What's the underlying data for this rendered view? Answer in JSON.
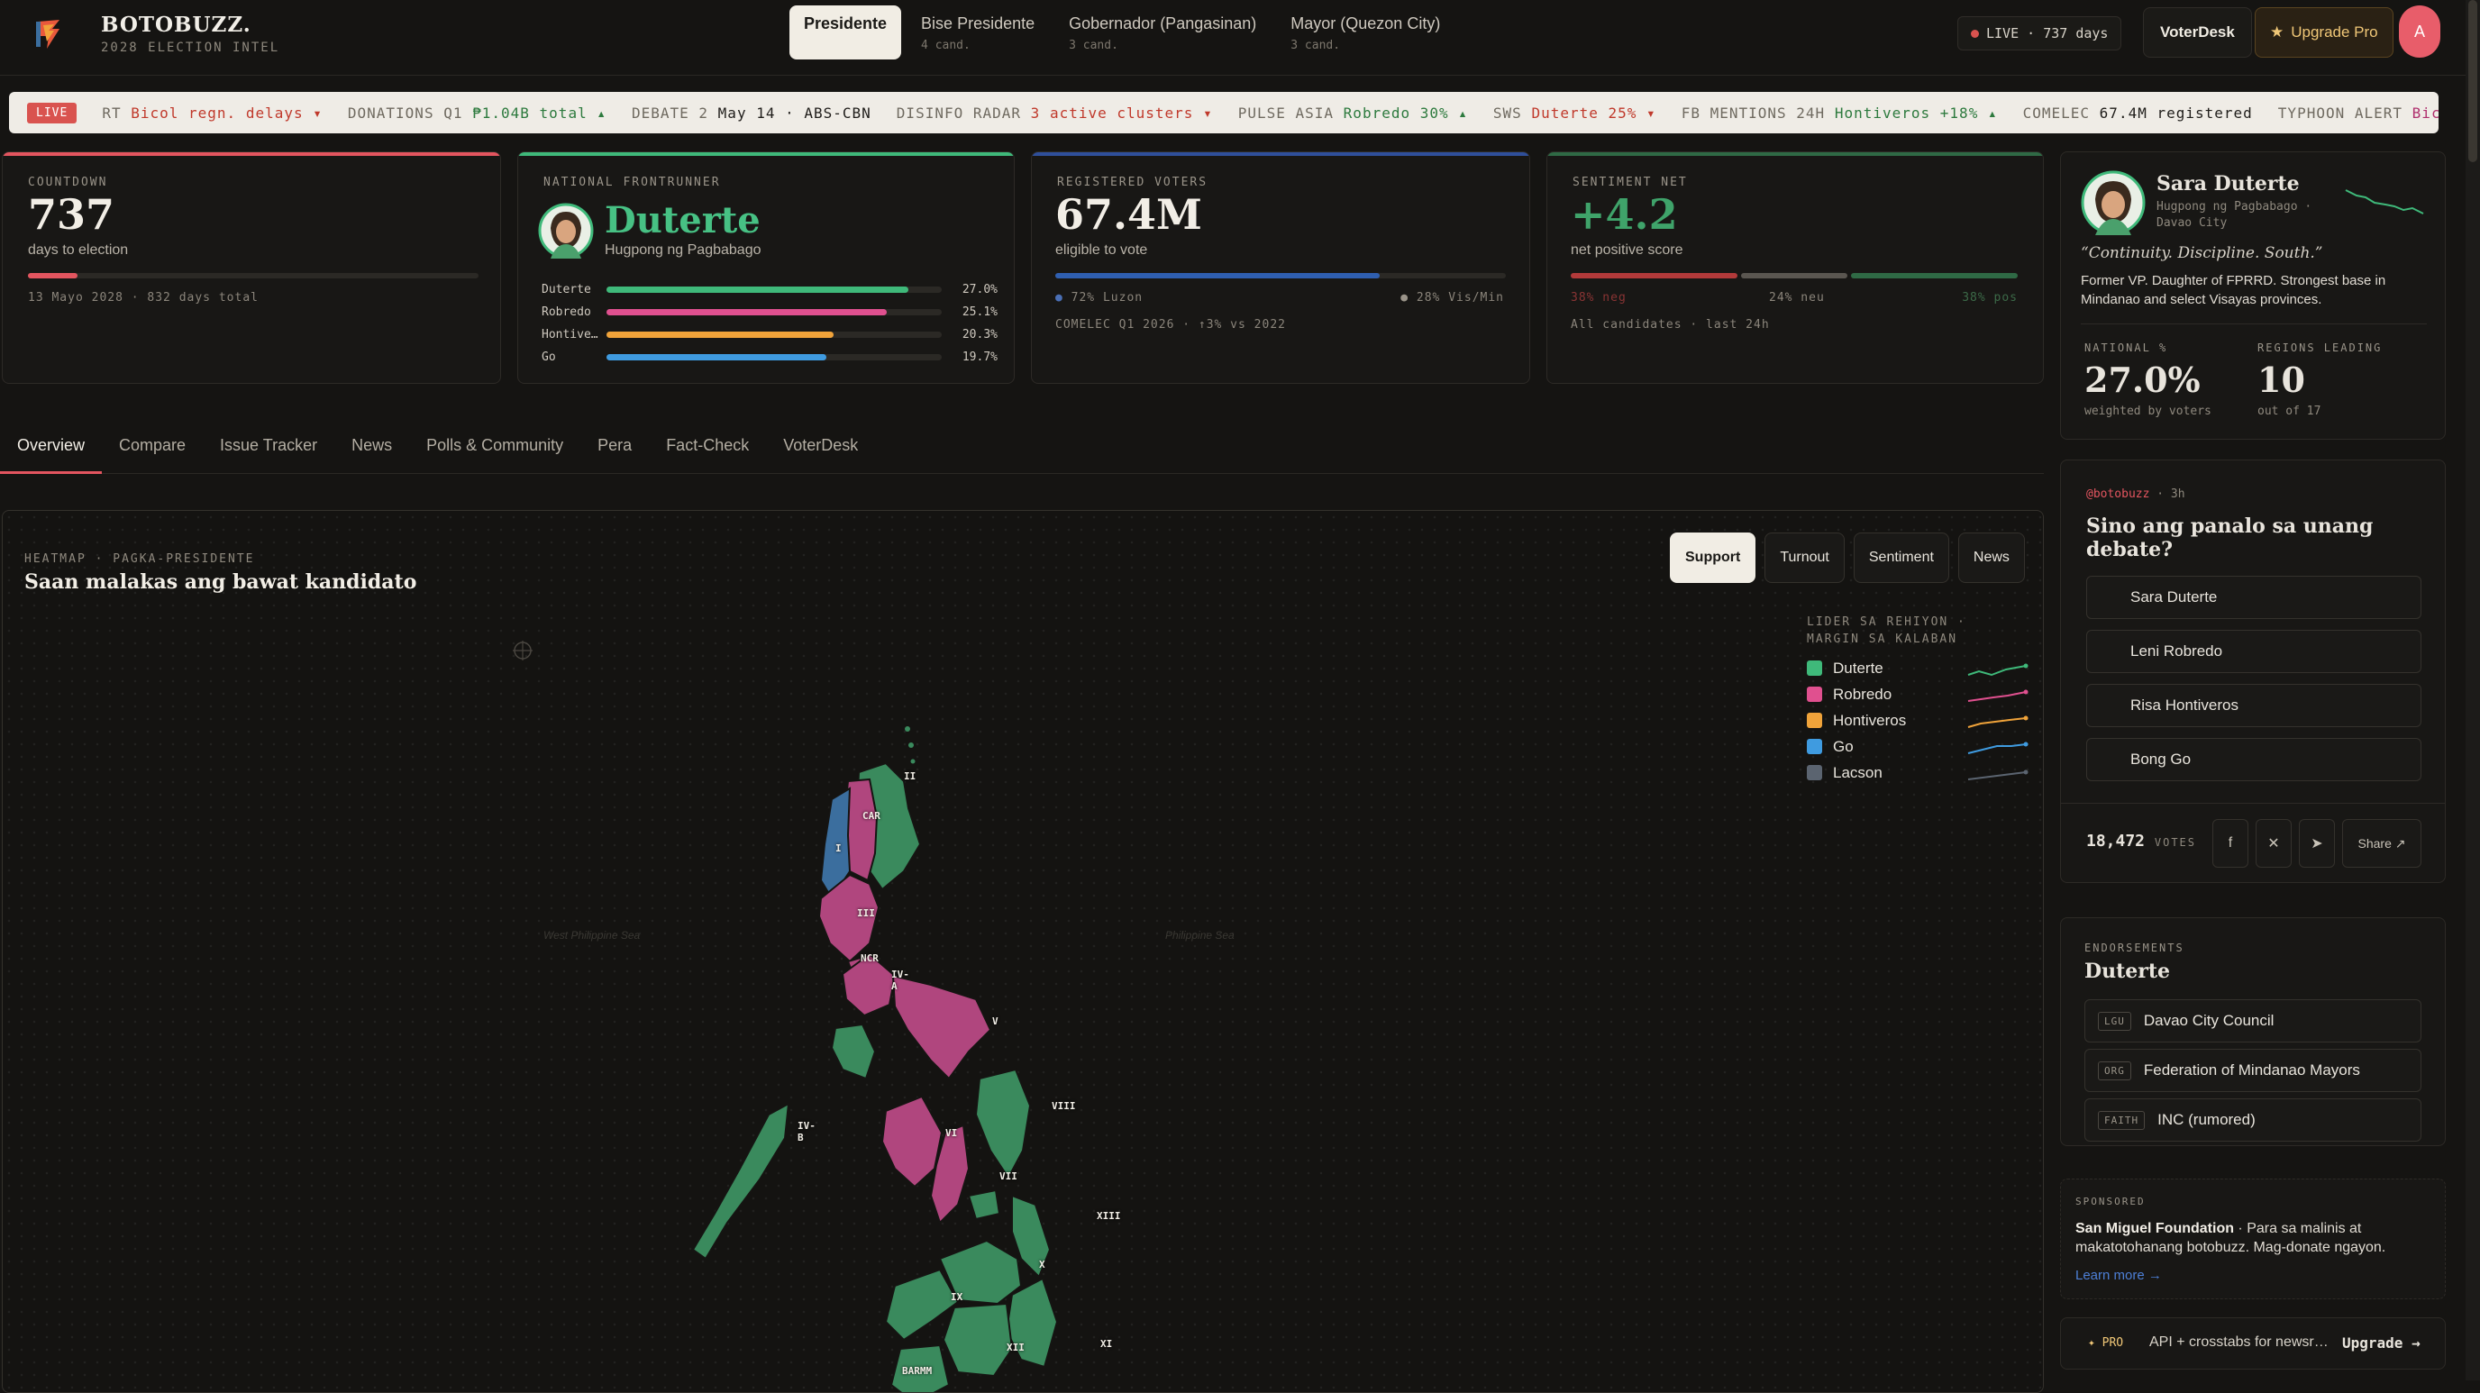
{
  "brand": {
    "title": "BOTOBUZZ.",
    "subtitle": "2028 ELECTION INTEL"
  },
  "race_tabs": [
    {
      "label": "Presidente",
      "count": "",
      "active": true
    },
    {
      "label": "Bise Presidente",
      "count": "4 cand."
    },
    {
      "label": "Gobernador (Pangasinan)",
      "count": "3 cand."
    },
    {
      "label": "Mayor (Quezon City)",
      "count": "3 cand."
    }
  ],
  "header": {
    "live": "LIVE · 737 days",
    "voterdesk": "VoterDesk",
    "upgrade": "Upgrade Pro",
    "avatar_initial": "A"
  },
  "ticker": {
    "live_tag": "LIVE",
    "items": [
      {
        "label": "RT",
        "value": "Bicol regn. delays ▾"
      },
      {
        "label": "DONATIONS Q1",
        "value": "₱1.04B total ▴"
      },
      {
        "label": "DEBATE 2",
        "value": "May 14 · ABS-CBN"
      },
      {
        "label": "DISINFO RADAR",
        "value": "3 active clusters ▾"
      },
      {
        "label": "PULSE ASIA",
        "value": "Robredo 30% ▴"
      },
      {
        "label": "SWS",
        "value": "Duterte 25% ▾"
      },
      {
        "label": "FB MENTIONS 24H",
        "value": "Hontiveros +18% ▴"
      },
      {
        "label": "COMELEC",
        "value": "67.4M registered"
      },
      {
        "label": "TYPHOON ALERT",
        "value": "Bic"
      }
    ]
  },
  "countdown": {
    "label": "COUNTDOWN",
    "value": "737",
    "sub": "days to election",
    "foot": "13 Mayo 2028 · 832 days total",
    "progress": 0.11
  },
  "frontrunner": {
    "label": "NATIONAL FRONTRUNNER",
    "name": "Duterte",
    "party": "Hugpong ng Pagbabago",
    "rows": [
      {
        "name": "Duterte",
        "pct": "27.0%",
        "value": 27.0,
        "color": "#3fb97a"
      },
      {
        "name": "Robredo",
        "pct": "25.1%",
        "value": 25.1,
        "color": "#e0508f"
      },
      {
        "name": "Hontive…",
        "pct": "20.3%",
        "value": 20.3,
        "color": "#f0a33a"
      },
      {
        "name": "Go",
        "pct": "19.7%",
        "value": 19.7,
        "color": "#3f9be0"
      }
    ]
  },
  "voters": {
    "label": "REGISTERED VOTERS",
    "value": "67.4M",
    "sub": "eligible to vote",
    "luzon": "72% Luzon",
    "vismin": "28% Vis/Min",
    "luzon_share": 0.72,
    "foot": "COMELEC Q1 2026 · ↑3% vs 2022"
  },
  "sentiment": {
    "label": "SENTIMENT NET",
    "value": "+4.2",
    "sub": "net positive score",
    "neg": "38% neg",
    "neu": "24% neu",
    "pos": "38% pos",
    "neg_share": 0.38,
    "neu_share": 0.24,
    "pos_share": 0.38,
    "foot": "All candidates · last 24h"
  },
  "subnav": [
    "Overview",
    "Compare",
    "Issue Tracker",
    "News",
    "Polls & Community",
    "Pera",
    "Fact-Check",
    "VoterDesk"
  ],
  "map": {
    "kicker": "HEATMAP · PAGKA-PRESIDENTE",
    "title": "Saan malakas ang bawat kandidato",
    "modes": [
      "Support",
      "Turnout",
      "Sentiment",
      "News"
    ],
    "legend_title_1": "LIDER SA REHIYON ·",
    "legend_title_2": "MARGIN SA KALABAN",
    "legend": [
      {
        "name": "Duterte",
        "color": "#3fb97a"
      },
      {
        "name": "Robredo",
        "color": "#e0508f"
      },
      {
        "name": "Hontiveros",
        "color": "#f0a33a"
      },
      {
        "name": "Go",
        "color": "#3f9be0"
      },
      {
        "name": "Lacson",
        "color": "#5b6470"
      }
    ],
    "sea_west": "West Philippine Sea",
    "sea_east": "Philippine Sea",
    "regions": [
      "II",
      "CAR",
      "I",
      "III",
      "NCR",
      "IV-A",
      "V",
      "IV-B",
      "VIII",
      "VI",
      "VII",
      "XIII",
      "X",
      "IX",
      "XII",
      "XI",
      "BARMM"
    ],
    "colors": {
      "duterte": "#3a8a5d",
      "robredo": "#b0467e",
      "go": "#3b6e9e",
      "hontiveros": "#c88a33"
    }
  },
  "profile": {
    "name": "Sara Duterte",
    "party_line": "Hugpong ng Pagbabago · Davao City",
    "quote": "“Continuity. Discipline. South.”",
    "bio": "Former VP. Daughter of FPRRD. Strongest base in Mindanao and select Visayas provinces.",
    "national_label": "NATIONAL %",
    "national_value": "27.0%",
    "national_sub": "weighted by voters",
    "regions_label": "REGIONS LEADING",
    "regions_value": "10",
    "regions_sub": "out of 17"
  },
  "poll": {
    "handle": "@botobuzz",
    "time": "· 3h",
    "question": "Sino ang panalo sa unang debate?",
    "options": [
      "Sara Duterte",
      "Leni Robredo",
      "Risa Hontiveros",
      "Bong Go"
    ],
    "votes": "18,472",
    "votes_label": "VOTES",
    "share": "Share ↗"
  },
  "endorsements": {
    "label": "ENDORSEMENTS",
    "name": "Duterte",
    "items": [
      {
        "tag": "LGU",
        "text": "Davao City Council"
      },
      {
        "tag": "ORG",
        "text": "Federation of Mindanao Mayors"
      },
      {
        "tag": "FAITH",
        "text": "INC (rumored)"
      }
    ]
  },
  "sponsored": {
    "label": "SPONSORED",
    "sponsor": "San Miguel Foundation",
    "text": " · Para sa malinis at makatotohanang botobuzz. Mag-donate ngayon.",
    "link": "Learn more →"
  },
  "pro": {
    "tag": "✦ PRO",
    "text": "API + crosstabs for newsr…",
    "cta": "Upgrade →"
  }
}
